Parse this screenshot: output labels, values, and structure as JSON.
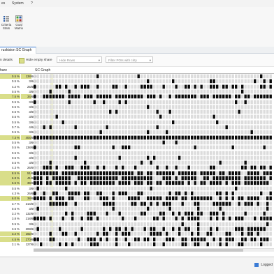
{
  "menu": {
    "items": [
      "es",
      "System",
      "?"
    ]
  },
  "ribbon": {
    "buttons": [
      {
        "label": "Criteria\nStats",
        "icon": "list-icon"
      },
      {
        "label": "Goal\nMatrix",
        "icon": "matrix-icon"
      }
    ]
  },
  "tab": {
    "label": "ruskision SC Graph"
  },
  "toolbar": {
    "details_label": "n details",
    "hide_empty_label": "Hide empty share",
    "hide_rows_placeholder": "Hide Rows",
    "filter_placeholder": "Filter POIs with crity"
  },
  "grid": {
    "share_header": "hare",
    "sc_header": "SC Graph"
  },
  "colors": {
    "highlight": "#d9de8a",
    "filled_slot": "#0a0a0a",
    "empty_slot": "#dcdcdc",
    "accent": "#3a7bd5"
  },
  "rows": [
    {
      "pct": "0.5 %",
      "ratio": "138/",
      "total": "600",
      "hl": true
    },
    {
      "pct": "0.5 %",
      "ratio": "3/",
      "total": "600",
      "hl": false
    },
    {
      "pct": "4.2 %",
      "ratio": "25/",
      "total": "600",
      "hl": false
    },
    {
      "pct": "0.5 %",
      "ratio": "3/",
      "total": "600",
      "hl": false
    },
    {
      "pct": "7.5 %",
      "ratio": "34/",
      "total": "600",
      "hl": true
    },
    {
      "pct": "0.5 %",
      "ratio": "3/",
      "total": "600",
      "hl": false
    },
    {
      "pct": "0.5 %",
      "ratio": "3/",
      "total": "600",
      "hl": false
    },
    {
      "pct": "0.5 %",
      "ratio": "3/",
      "total": "600",
      "hl": false
    },
    {
      "pct": "0.5 %",
      "ratio": "3/",
      "total": "600",
      "hl": false
    },
    {
      "pct": "0.5 %",
      "ratio": "3/",
      "total": "600",
      "hl": false
    },
    {
      "pct": "0.7 %",
      "ratio": "4/",
      "total": "600",
      "hl": false
    },
    {
      "pct": "0.5 %",
      "ratio": "3/",
      "total": "600",
      "hl": false
    },
    {
      "pct": "7.3 %",
      "ratio": "404/",
      "total": "600",
      "hl": true
    },
    {
      "pct": "0.5 %",
      "ratio": "3/",
      "total": "600",
      "hl": false
    },
    {
      "pct": "0.5 %",
      "ratio": "138/",
      "total": "600",
      "hl": false
    },
    {
      "pct": "0.5 %",
      "ratio": "3/",
      "total": "600",
      "hl": false
    },
    {
      "pct": "0.5 %",
      "ratio": "3/",
      "total": "600",
      "hl": false
    },
    {
      "pct": "0.5 %",
      "ratio": "3/",
      "total": "600",
      "hl": false
    },
    {
      "pct": "4.3 %",
      "ratio": "26/",
      "total": "600",
      "hl": false
    },
    {
      "pct": "8.5 %",
      "ratio": "51/",
      "total": "600",
      "hl": true
    },
    {
      "pct": "6.8 %",
      "ratio": "41/",
      "total": "600",
      "hl": true
    },
    {
      "pct": "6.5 %",
      "ratio": "39/",
      "total": "600",
      "hl": true
    },
    {
      "pct": "0.5 %",
      "ratio": "3/",
      "total": "600",
      "hl": false
    },
    {
      "pct": "4.3 %",
      "ratio": "26/",
      "total": "600",
      "hl": false
    },
    {
      "pct": "6.0 %",
      "ratio": "38/",
      "total": "600",
      "hl": true
    },
    {
      "pct": "3.7 %",
      "ratio": "214/",
      "total": "600",
      "hl": false
    },
    {
      "pct": "0.5 %",
      "ratio": "3/",
      "total": "600",
      "hl": false
    },
    {
      "pct": "3.2 %",
      "ratio": "132/",
      "total": "600",
      "hl": false
    },
    {
      "pct": "3.8 %",
      "ratio": "218/",
      "total": "600",
      "hl": false
    },
    {
      "pct": "0.5 %",
      "ratio": "3/",
      "total": "600",
      "hl": false
    },
    {
      "pct": "3.5 %",
      "ratio": "208/",
      "total": "600",
      "hl": false
    },
    {
      "pct": "3.2 %",
      "ratio": "192/",
      "total": "600",
      "hl": true
    },
    {
      "pct": "4.5 %",
      "ratio": "270/",
      "total": "600",
      "hl": true
    },
    {
      "pct": "2.1 %",
      "ratio": "127/",
      "total": "600",
      "hl": false
    }
  ],
  "status": {
    "text": "Logged"
  }
}
